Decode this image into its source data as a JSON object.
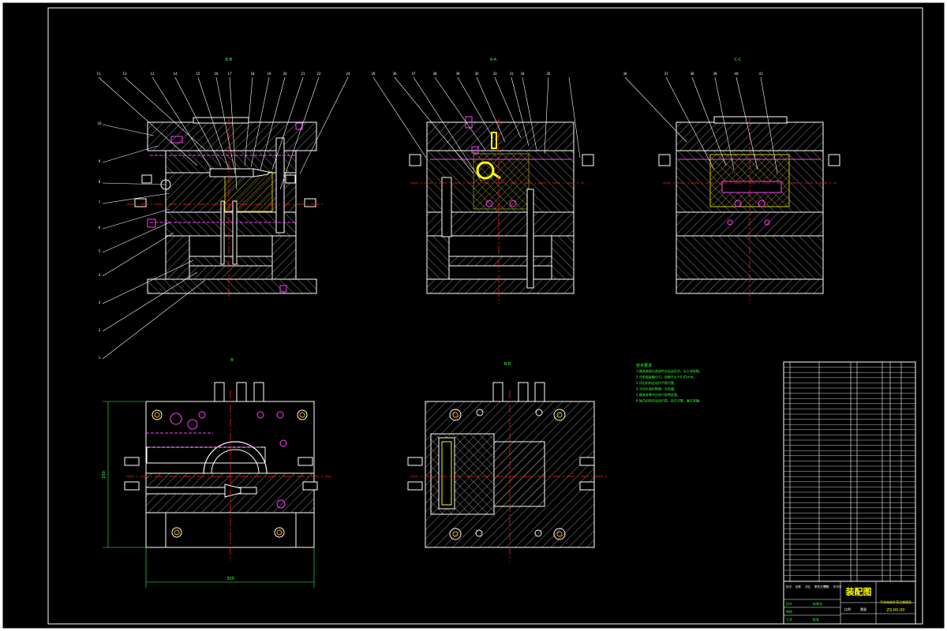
{
  "colors": {
    "paper": "#000000",
    "outline": "#ffffff",
    "hatch": "#cfcfcf",
    "center_line": "#ff2020",
    "hidden": "#ff40ff",
    "note_text": "#33ff33",
    "highlight": "#ffff00",
    "dim": "#33ff66",
    "margin": "#ffffff"
  },
  "views": {
    "view1_label": "B-B",
    "view2_label": "A-A",
    "view3_label": "C-C",
    "view4_label": "B",
    "view5_label": "B-B"
  },
  "balloons_top_left": [
    "11",
    "13",
    "12",
    "14",
    "15",
    "16",
    "17",
    "18",
    "19",
    "20",
    "21",
    "22",
    "24"
  ],
  "balloons_left": [
    "10",
    "9",
    "8",
    "7",
    "6",
    "5",
    "4",
    "3",
    "2",
    "1"
  ],
  "balloons_mid": [
    "26",
    "36",
    "37",
    "38",
    "39",
    "30",
    "33",
    "31",
    "34",
    "35"
  ],
  "balloons_right": [
    "36",
    "37",
    "38",
    "39",
    "40",
    "41"
  ],
  "dims": {
    "width": "300",
    "height": "250"
  },
  "notes": {
    "title": "技术要求",
    "lines": [
      "1.模具装配后各部件应运动灵活，无卡滞现象。",
      "2.分型面接触均匀，间隙不大于0.02mm。",
      "3.顶出机构应动作平稳可靠。",
      "4.冷却水道应畅通，无渗漏。",
      "5.模具各零件应进行防锈处理。",
      "6.抽芯机构应运动平稳，定位可靠，复位准确。"
    ]
  },
  "title_block": {
    "drawing_name": "装配图",
    "part_name": "手机电池外壳注塑模具",
    "drawing_no": "ZS-00-00",
    "header_labels": [
      "标记",
      "处数",
      "分区",
      "更改文件号",
      "签名",
      "年月日"
    ],
    "labels": [
      "设计",
      "审核",
      "工艺",
      "批准",
      "标准化"
    ],
    "scale_label": "比例",
    "weight_label": "重量"
  }
}
